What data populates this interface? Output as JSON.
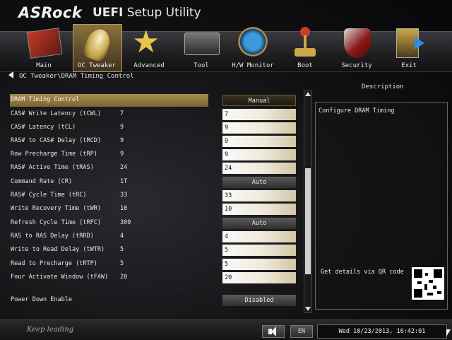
{
  "app": {
    "brand": "ASRock",
    "title_bold": "UEFI",
    "title_rest": " Setup Utility"
  },
  "nav": [
    {
      "label": "Main",
      "icon": "card-icon"
    },
    {
      "label": "OC Tweaker",
      "icon": "rocket-icon"
    },
    {
      "label": "Advanced",
      "icon": "star-icon"
    },
    {
      "label": "Tool",
      "icon": "toolbox-icon"
    },
    {
      "label": "H/W Monitor",
      "icon": "radar-icon"
    },
    {
      "label": "Boot",
      "icon": "joystick-icon"
    },
    {
      "label": "Security",
      "icon": "shield-icon"
    },
    {
      "label": "Exit",
      "icon": "exit-door-icon"
    }
  ],
  "breadcrumb": "OC Tweaker\\DRAM Timing Control",
  "description": {
    "header": "Description",
    "text": "Configure DRAM Timing",
    "qr_text": "Get details via QR code"
  },
  "rows": [
    {
      "name": "DRAM Timing Control",
      "current": "",
      "value": "Manual"
    },
    {
      "name": "CAS# Write Latency (tCWL)",
      "current": "7",
      "value": "7"
    },
    {
      "name": "CAS# Latency (tCL)",
      "current": "9",
      "value": "9"
    },
    {
      "name": "RAS# to CAS# Delay (tRCD)",
      "current": "9",
      "value": "9"
    },
    {
      "name": "Row Precharge Time (tRP)",
      "current": "9",
      "value": "9"
    },
    {
      "name": "RAS# Active Time (tRAS)",
      "current": "24",
      "value": "24"
    },
    {
      "name": "Command Rate (CR)",
      "current": "1T",
      "value": "Auto"
    },
    {
      "name": "RAS# Cycle Time (tRC)",
      "current": "33",
      "value": "33"
    },
    {
      "name": "Write Recovery Time (tWR)",
      "current": "10",
      "value": "10"
    },
    {
      "name": "Refresh Cycle Time (tRFC)",
      "current": "300",
      "value": "Auto"
    },
    {
      "name": "RAS to RAS Delay (tRRD)",
      "current": "4",
      "value": "4"
    },
    {
      "name": "Write to Read Delay (tWTR)",
      "current": "5",
      "value": "5"
    },
    {
      "name": "Read to Precharge (tRTP)",
      "current": "5",
      "value": "5"
    },
    {
      "name": "Four Activate Window (tFAW)",
      "current": "20",
      "value": "20"
    },
    {
      "name": "Power Down Enable",
      "current": "",
      "value": "Disabled"
    }
  ],
  "footer": {
    "slogan": "Keep leading",
    "lang": "EN",
    "datetime": "Wed 10/23/2013, 16:42:01"
  }
}
